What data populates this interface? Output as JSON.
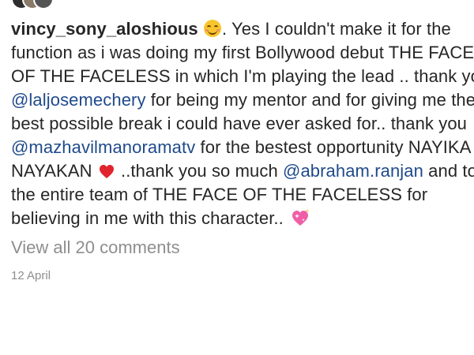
{
  "post": {
    "username": "vincy_sony_aloshious",
    "caption_lines": [
      {
        "parts": [
          ". Yes I couldn't make it for the"
        ]
      },
      "function as i was doing my first Bollywood debut THE FACE",
      "OF THE FACELESS in which I'm playing the lead .. thank you",
      {
        "mention": "@laljosemechery",
        "text": " for being my mentor and for giving me the"
      },
      "best possible break i could have ever asked for.. thank you",
      {
        "mention": "@mazhavilmanoramatv",
        "text": " for the bestest opportunity NAYIKA"
      },
      {
        "before": "NAYAKAN ",
        "after": " ..thank you so much ",
        "mention": "@abraham.ranjan",
        "end": " and to"
      },
      "the entire team of THE FACE OF THE FACELESS for",
      "believing in me with this character.. "
    ],
    "view_comments": "View all 20 comments",
    "date": "12 April"
  },
  "icons": {
    "emoji_1": "smiling-face-emoji",
    "emoji_2": "red-heart-emoji",
    "emoji_3": "sparkling-heart-emoji"
  },
  "colors": {
    "text": "#262626",
    "mention": "#1f4a8c",
    "muted": "#8e8e8e"
  }
}
